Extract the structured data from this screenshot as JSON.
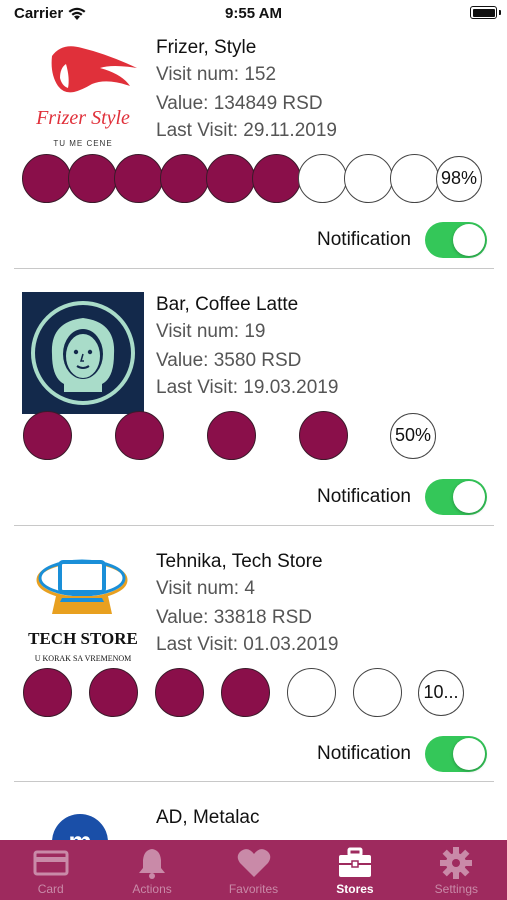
{
  "status_bar": {
    "carrier": "Carrier",
    "time": "9:55 AM"
  },
  "stores": [
    {
      "name": "Frizer, Style",
      "visit_num": "Visit num: 152",
      "value": "Value: 134849 RSD",
      "last_visit": "Last Visit: 29.11.2019",
      "progress_percent": "98%",
      "filled_dots": 6,
      "total_dots": 9,
      "notification_label": "Notification",
      "notification_on": true,
      "logo": {
        "title": "Frizer Style",
        "tagline": "TU ME CENE",
        "color": "#e0303a"
      }
    },
    {
      "name": "Bar, Coffee Latte",
      "visit_num": "Visit num: 19",
      "value": "Value: 3580 RSD",
      "last_visit": "Last Visit: 19.03.2019",
      "progress_percent": "50%",
      "filled_dots": 4,
      "total_dots": 4,
      "notification_label": "Notification",
      "notification_on": true,
      "logo": {
        "bg": "#13294b",
        "fg": "#a9dcc9"
      }
    },
    {
      "name": "Tehnika, Tech Store",
      "visit_num": "Visit num: 4",
      "value": "Value: 33818 RSD",
      "last_visit": "Last Visit: 01.03.2019",
      "progress_percent": "10...",
      "filled_dots": 4,
      "total_dots": 6,
      "notification_label": "Notification",
      "notification_on": true,
      "logo": {
        "title": "TECH STORE",
        "tagline": "U KORAK SA VREMENOM"
      }
    },
    {
      "name": "AD, Metalac"
    }
  ],
  "tabs": [
    {
      "label": "Card",
      "icon": "card-icon",
      "active": false
    },
    {
      "label": "Actions",
      "icon": "bell-icon",
      "active": false
    },
    {
      "label": "Favorites",
      "icon": "heart-icon",
      "active": false
    },
    {
      "label": "Stores",
      "icon": "briefcase-icon",
      "active": true
    },
    {
      "label": "Settings",
      "icon": "gear-icon",
      "active": false
    }
  ],
  "colors": {
    "accent": "#8a0f4a",
    "tabbar": "#9e2a5e",
    "toggle_on": "#34c759"
  }
}
